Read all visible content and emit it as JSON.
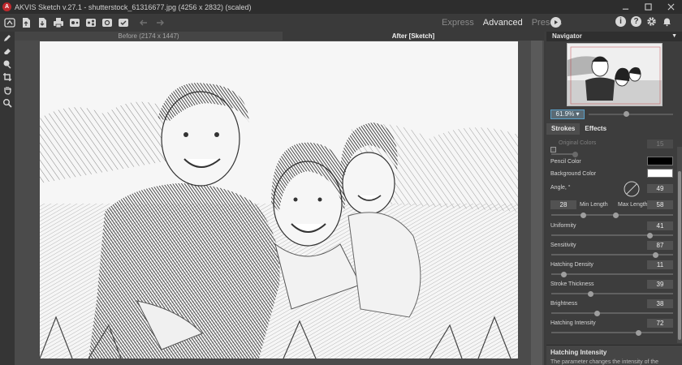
{
  "window": {
    "title": "AKVIS Sketch v.27.1 - shutterstock_61316677.jpg (4256 x 2832) (scaled)",
    "logo_letter": "A"
  },
  "toolbar": {
    "modes": [
      "Express",
      "Advanced",
      "Presets"
    ],
    "active_mode": "Advanced",
    "icons": [
      "home-icon",
      "open-file-icon",
      "save-icon",
      "print-icon",
      "batch-icon",
      "share-icon",
      "settings-plugin-icon",
      "check-icon",
      "undo-icon",
      "redo-icon"
    ],
    "right_icons": [
      "info-icon",
      "help-icon",
      "gear-icon",
      "notifications-icon"
    ]
  },
  "view_tabs": {
    "before": "Before (2174 x 1447)",
    "after": "After [Sketch]"
  },
  "navigator": {
    "title": "Navigator",
    "zoom": "61.9%",
    "zoom_level": 0.65
  },
  "panel_tabs": [
    "Strokes",
    "Effects"
  ],
  "params": {
    "original_colors": {
      "label": "Original Colors",
      "value": "15",
      "checked": false
    },
    "pencil_color": {
      "label": "Pencil Color",
      "color": "#000000"
    },
    "background_color": {
      "label": "Background Color",
      "color": "#ffffff"
    },
    "angle": {
      "label": "Angle, °",
      "value": "49"
    },
    "min_length": {
      "label": "Min Length",
      "value": "28"
    },
    "max_length": {
      "label": "Max Length",
      "value": "58"
    },
    "uniformity": {
      "label": "Uniformity",
      "value": "41",
      "level": 0.41
    },
    "sensitivity": {
      "label": "Sensitivity",
      "value": "87",
      "level": 0.87
    },
    "hatching_density": {
      "label": "Hatching Density",
      "value": "11",
      "level": 0.11
    },
    "stroke_thickness": {
      "label": "Stroke Thickness",
      "value": "39",
      "level": 0.39
    },
    "brightness": {
      "label": "Brightness",
      "value": "38",
      "level": 0.38
    },
    "hatching_intensity": {
      "label": "Hatching Intensity",
      "value": "72",
      "level": 0.72
    }
  },
  "help": {
    "title": "Hatching Intensity",
    "text": "The parameter changes the intensity of the"
  }
}
